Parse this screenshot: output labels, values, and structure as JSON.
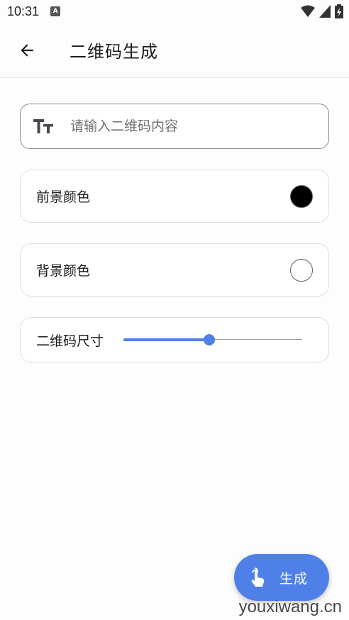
{
  "status_bar": {
    "time": "10:31",
    "notification_letter": "A",
    "icons": [
      "wifi-icon",
      "cellular-signal-icon",
      "battery-charging-icon"
    ]
  },
  "app_bar": {
    "title": "二维码生成",
    "back_icon": "arrow-left-icon"
  },
  "content_input": {
    "placeholder": "请输入二维码内容",
    "value": "",
    "icon": "text-size-icon"
  },
  "foreground_color": {
    "label": "前景颜色",
    "color": "#000000"
  },
  "background_color": {
    "label": "背景颜色",
    "color": "#ffffff"
  },
  "qr_size": {
    "label": "二维码尺寸",
    "slider_value_fraction": 0.48
  },
  "fab": {
    "label": "生成",
    "icon": "tap-hand-icon",
    "color": "#4f80e8"
  },
  "watermark": "youxiwang.cn"
}
